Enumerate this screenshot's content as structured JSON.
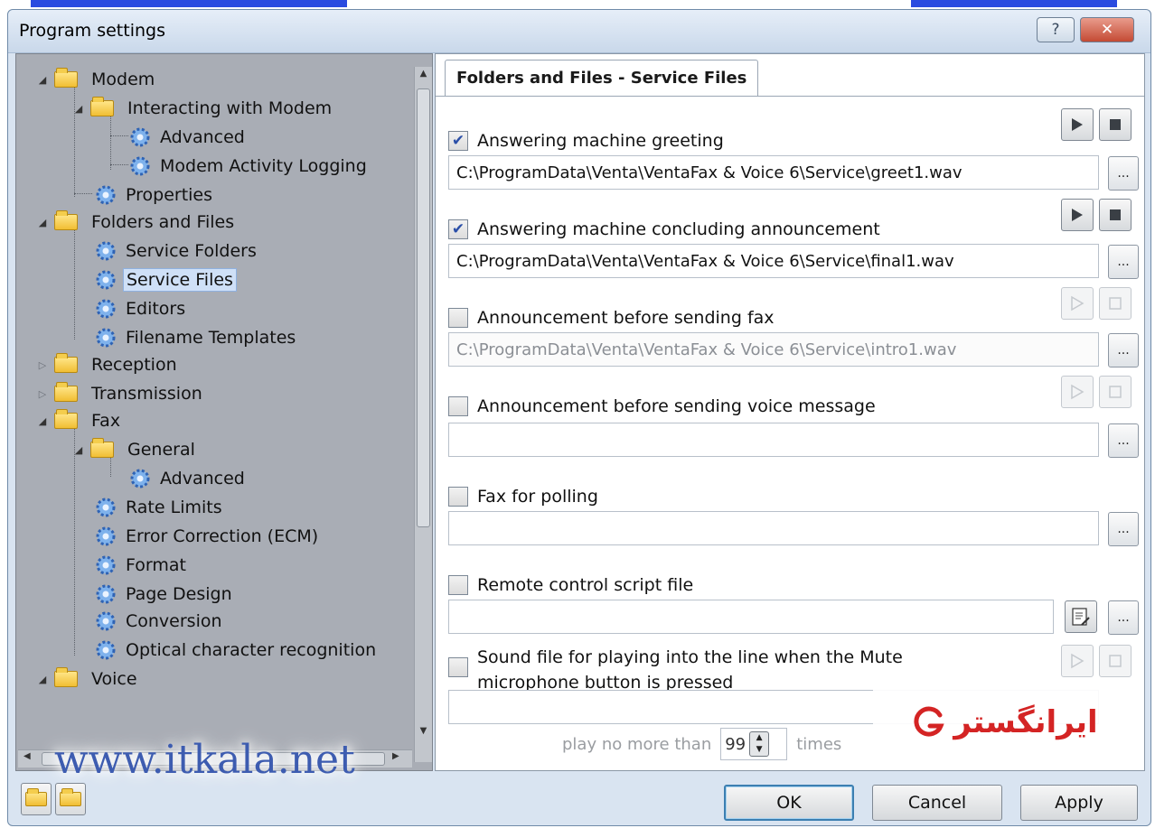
{
  "window": {
    "title": "Program settings",
    "help_label": "?",
    "close_label": "✕"
  },
  "tree": {
    "items": [
      {
        "label": "Modem",
        "kind": "folder",
        "expanded": true
      },
      {
        "label": "Interacting with Modem",
        "kind": "folder",
        "expanded": true
      },
      {
        "label": "Advanced",
        "kind": "gear"
      },
      {
        "label": "Modem Activity Logging",
        "kind": "gear"
      },
      {
        "label": "Properties",
        "kind": "gear"
      },
      {
        "label": "Folders and Files",
        "kind": "folder",
        "expanded": true
      },
      {
        "label": "Service Folders",
        "kind": "gear"
      },
      {
        "label": "Service Files",
        "kind": "gear",
        "selected": true
      },
      {
        "label": "Editors",
        "kind": "gear"
      },
      {
        "label": "Filename Templates",
        "kind": "gear"
      },
      {
        "label": "Reception",
        "kind": "folder",
        "expanded": false
      },
      {
        "label": "Transmission",
        "kind": "folder",
        "expanded": false
      },
      {
        "label": "Fax",
        "kind": "folder",
        "expanded": true
      },
      {
        "label": "General",
        "kind": "folder",
        "expanded": true
      },
      {
        "label": "Advanced",
        "kind": "gear"
      },
      {
        "label": "Rate Limits",
        "kind": "gear"
      },
      {
        "label": "Error Correction (ECM)",
        "kind": "gear"
      },
      {
        "label": "Format",
        "kind": "gear"
      },
      {
        "label": "Page Design",
        "kind": "gear"
      },
      {
        "label": "Conversion",
        "kind": "gear"
      },
      {
        "label": "Optical character recognition",
        "kind": "gear"
      },
      {
        "label": "Voice",
        "kind": "folder",
        "expanded": true
      }
    ]
  },
  "settings": {
    "tab_label": "Folders and Files - Service Files",
    "entries": [
      {
        "label": "Answering machine greeting",
        "checked": true,
        "path": "C:\\ProgramData\\Venta\\VentaFax & Voice 6\\Service\\greet1.wav",
        "enabled": true
      },
      {
        "label": "Answering machine concluding announcement",
        "checked": true,
        "path": "C:\\ProgramData\\Venta\\VentaFax & Voice 6\\Service\\final1.wav",
        "enabled": true
      },
      {
        "label": "Announcement before sending fax",
        "checked": false,
        "path": "C:\\ProgramData\\Venta\\VentaFax & Voice 6\\Service\\intro1.wav",
        "enabled": false
      },
      {
        "label": "Announcement before sending voice message",
        "checked": false,
        "path": "",
        "enabled": false
      },
      {
        "label": "Fax for polling",
        "checked": false,
        "path": "",
        "enabled": false
      },
      {
        "label": "Remote control script file",
        "checked": false,
        "path": "",
        "enabled": false
      },
      {
        "label_line1": "Sound file for playing into the line when the Mute",
        "label_line2": "microphone button is pressed",
        "checked": false,
        "path": "",
        "enabled": false
      }
    ],
    "browse_label": "...",
    "play_limit_prefix": "play no more than",
    "play_limit_value": "99",
    "play_limit_suffix": "times"
  },
  "footer": {
    "ok_label": "OK",
    "cancel_label": "Cancel",
    "apply_label": "Apply"
  },
  "watermarks": {
    "url": "www.itkala.net",
    "brand": "ایرانگستر"
  },
  "colors": {
    "tree_bg": "#a9adb5",
    "selection": "#cfe0f7",
    "accent": "#3c7fb1",
    "brand_red": "#d42424"
  }
}
